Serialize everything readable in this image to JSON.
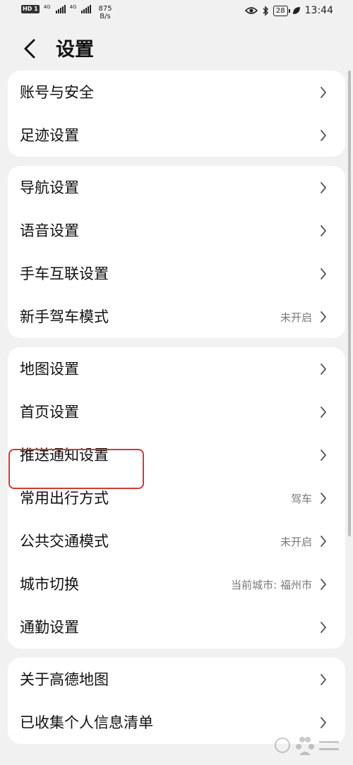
{
  "status_bar": {
    "network_1": "4G",
    "network_2": "4G",
    "speed_value": "875",
    "speed_unit": "B/s",
    "battery": "28",
    "time": "13:44"
  },
  "header": {
    "title": "设置"
  },
  "groups": [
    {
      "items": [
        {
          "label": "账号与安全",
          "value": ""
        },
        {
          "label": "足迹设置",
          "value": ""
        }
      ]
    },
    {
      "items": [
        {
          "label": "导航设置",
          "value": ""
        },
        {
          "label": "语音设置",
          "value": ""
        },
        {
          "label": "手车互联设置",
          "value": ""
        },
        {
          "label": "新手驾车模式",
          "value": "未开启"
        }
      ]
    },
    {
      "items": [
        {
          "label": "地图设置",
          "value": ""
        },
        {
          "label": "首页设置",
          "value": ""
        },
        {
          "label": "推送通知设置",
          "value": ""
        },
        {
          "label": "常用出行方式",
          "value": "驾车"
        },
        {
          "label": "公共交通模式",
          "value": "未开启"
        },
        {
          "label": "城市切换",
          "value": "当前城市: 福州市"
        },
        {
          "label": "通勤设置",
          "value": ""
        }
      ]
    },
    {
      "items": [
        {
          "label": "关于高德地图",
          "value": ""
        },
        {
          "label": "已收集个人信息清单",
          "value": ""
        }
      ]
    }
  ]
}
